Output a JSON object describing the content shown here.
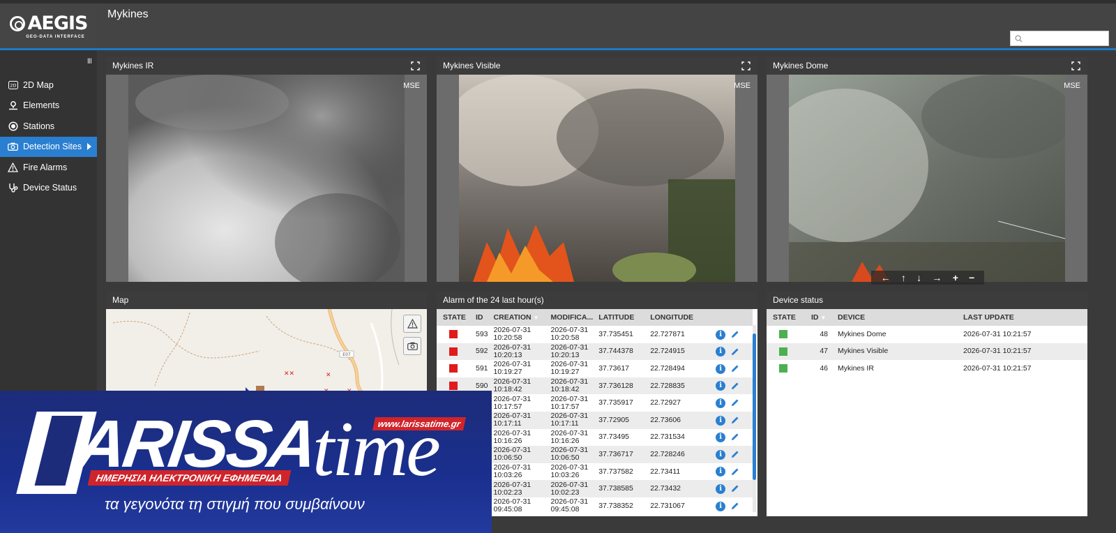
{
  "app": {
    "logo_text": "AEGIS",
    "logo_subtitle": "GEO-DATA INTERFACE",
    "page_title": "Mykines",
    "search_placeholder": ""
  },
  "sidebar": {
    "collapse_label": "III",
    "items": [
      {
        "label": "2D Map",
        "icon": "2d-map-icon"
      },
      {
        "label": "Elements",
        "icon": "location-pin-icon"
      },
      {
        "label": "Stations",
        "icon": "station-icon"
      },
      {
        "label": "Detection Sites",
        "icon": "camera-icon",
        "active": true
      },
      {
        "label": "Fire Alarms",
        "icon": "warning-icon"
      },
      {
        "label": "Device Status",
        "icon": "stethoscope-icon"
      }
    ]
  },
  "cameras": [
    {
      "title": "Mykines IR",
      "badge": "MSE"
    },
    {
      "title": "Mykines Visible",
      "badge": "MSE"
    },
    {
      "title": "Mykines Dome",
      "badge": "MSE"
    }
  ],
  "ptz_controls": [
    "←",
    "↑",
    "↓",
    "→",
    "+",
    "−"
  ],
  "map_panel": {
    "title": "Map",
    "road_label": "E07"
  },
  "alarms": {
    "title": "Alarm of the 24 last hour(s)",
    "columns": [
      "STATE",
      "ID",
      "CREATION",
      "MODIFICA...",
      "LATITUDE",
      "LONGITUDE"
    ],
    "state_color": "#e01b1b",
    "rows": [
      {
        "id": "593",
        "creation_date": "2026-07-31",
        "creation_time": "10:20:58",
        "mod_date": "2026-07-31",
        "mod_time": "10:20:58",
        "lat": "37.735451",
        "lon": "22.727871"
      },
      {
        "id": "592",
        "creation_date": "2026-07-31",
        "creation_time": "10:20:13",
        "mod_date": "2026-07-31",
        "mod_time": "10:20:13",
        "lat": "37.744378",
        "lon": "22.724915"
      },
      {
        "id": "591",
        "creation_date": "2026-07-31",
        "creation_time": "10:19:27",
        "mod_date": "2026-07-31",
        "mod_time": "10:19:27",
        "lat": "37.73617",
        "lon": "22.728494"
      },
      {
        "id": "590",
        "creation_date": "2026-07-31",
        "creation_time": "10:18:42",
        "mod_date": "2026-07-31",
        "mod_time": "10:18:42",
        "lat": "37.736128",
        "lon": "22.728835"
      },
      {
        "id": "",
        "creation_date": "2026-07-31",
        "creation_time": "10:17:57",
        "mod_date": "2026-07-31",
        "mod_time": "10:17:57",
        "lat": "37.735917",
        "lon": "22.72927"
      },
      {
        "id": "",
        "creation_date": "2026-07-31",
        "creation_time": "10:17:11",
        "mod_date": "2026-07-31",
        "mod_time": "10:17:11",
        "lat": "37.72905",
        "lon": "22.73606"
      },
      {
        "id": "",
        "creation_date": "2026-07-31",
        "creation_time": "10:16:26",
        "mod_date": "2026-07-31",
        "mod_time": "10:16:26",
        "lat": "37.73495",
        "lon": "22.731534"
      },
      {
        "id": "",
        "creation_date": "2026-07-31",
        "creation_time": "10:06:50",
        "mod_date": "2026-07-31",
        "mod_time": "10:06:50",
        "lat": "37.736717",
        "lon": "22.728246"
      },
      {
        "id": "",
        "creation_date": "2026-07-31",
        "creation_time": "10:03:26",
        "mod_date": "2026-07-31",
        "mod_time": "10:03:26",
        "lat": "37.737582",
        "lon": "22.73411"
      },
      {
        "id": "",
        "creation_date": "2026-07-31",
        "creation_time": "10:02:23",
        "mod_date": "2026-07-31",
        "mod_time": "10:02:23",
        "lat": "37.738585",
        "lon": "22.73432"
      },
      {
        "id": "",
        "creation_date": "2026-07-31",
        "creation_time": "09:45:08",
        "mod_date": "2026-07-31",
        "mod_time": "09:45:08",
        "lat": "37.738352",
        "lon": "22.731067"
      }
    ]
  },
  "devices": {
    "title": "Device status",
    "columns": [
      "STATE",
      "ID",
      "DEVICE",
      "LAST UPDATE"
    ],
    "state_color": "#4caf50",
    "rows": [
      {
        "id": "48",
        "device": "Mykines Dome",
        "last_update": "2026-07-31 10:21:57"
      },
      {
        "id": "47",
        "device": "Mykines Visible",
        "last_update": "2026-07-31 10:21:57"
      },
      {
        "id": "46",
        "device": "Mykines IR",
        "last_update": "2026-07-31 10:21:57"
      }
    ]
  },
  "overlay_banner": {
    "brand_first": "ARISSA",
    "brand_second": "time",
    "url": "www.larissatime.gr",
    "tagline": "ΗΜΕΡΗΣΙΑ ΗΛΕΚΤΡΟΝΙΚΗ ΕΦΗΜΕΡΙΔΑ",
    "slogan": "τα γεγονότα τη στιγμή που συμβαίνουν"
  }
}
